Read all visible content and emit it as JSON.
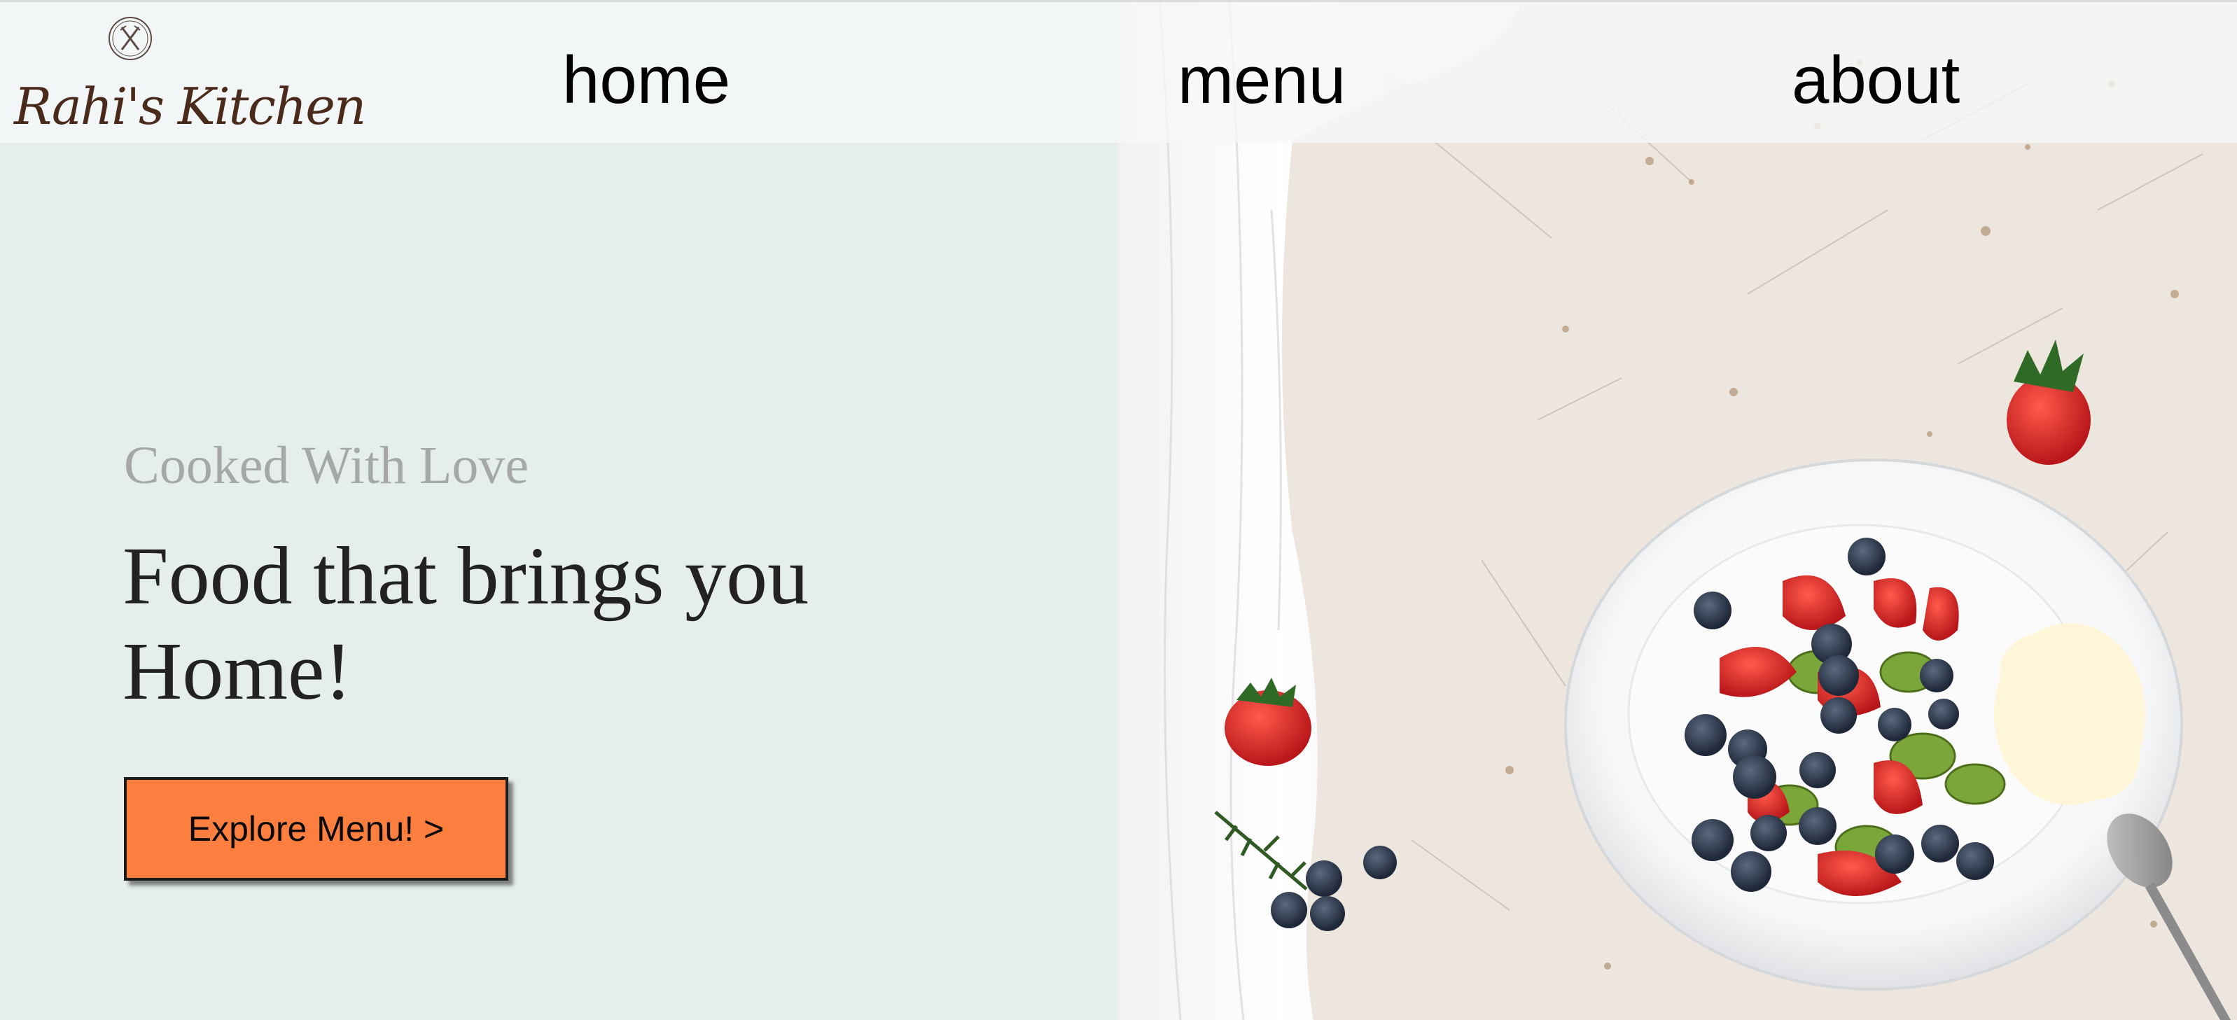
{
  "brand": {
    "logo_text": "Rahi's Kitchen",
    "logo_emblem": "utensils-emblem-icon",
    "color": "#4a2a1b"
  },
  "nav": {
    "items": [
      {
        "label": "home"
      },
      {
        "label": "menu"
      },
      {
        "label": "about"
      }
    ]
  },
  "hero": {
    "tagline": "Cooked With Love",
    "headline": "Food that brings you Home!",
    "cta_label": "Explore Menu! >",
    "cta_color": "#fd7f3f",
    "background_color": "#e6eeeb",
    "image": "fruit-salad-plate-photo"
  }
}
